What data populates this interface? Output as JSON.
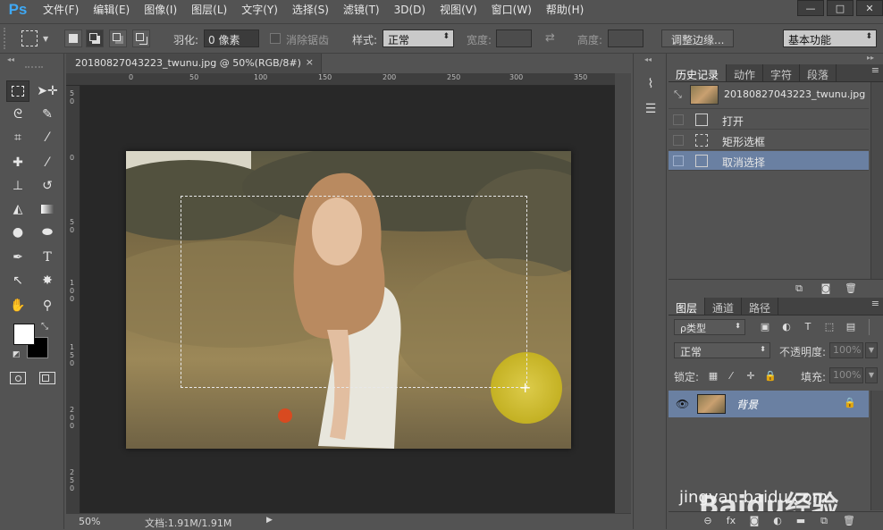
{
  "app": {
    "logo": "Ps"
  },
  "menu": [
    "文件(F)",
    "编辑(E)",
    "图像(I)",
    "图层(L)",
    "文字(Y)",
    "选择(S)",
    "滤镜(T)",
    "3D(D)",
    "视图(V)",
    "窗口(W)",
    "帮助(H)"
  ],
  "window_controls": [
    "—",
    "□",
    "✕"
  ],
  "options": {
    "feather_label": "羽化:",
    "feather_value": "0 像素",
    "antialias_label": "消除锯齿",
    "style_label": "样式:",
    "style_value": "正常",
    "width_label": "宽度:",
    "height_label": "高度:",
    "refine_edge": "调整边缘...",
    "workspace": "基本功能"
  },
  "document": {
    "tab_title": "20180827043223_twunu.jpg @ 50%(RGB/8#)",
    "tab_close": "×",
    "ruler_h_ticks": [
      "0",
      "50",
      "100",
      "150",
      "200",
      "250",
      "300",
      "350"
    ],
    "ruler_v_ticks": [
      "5\n0",
      "0",
      "5\n0",
      "1\n0\n0",
      "1\n5\n0",
      "2\n0\n0",
      "2\n5\n0"
    ],
    "zoom": "50%",
    "doc_info": "文档:1.91M/1.91M"
  },
  "history_panel": {
    "tabs": [
      "历史记录",
      "动作",
      "字符",
      "段落"
    ],
    "snapshot_name": "20180827043223_twunu.jpg",
    "items": [
      {
        "label": "打开",
        "icon": "document-icon",
        "selected": false
      },
      {
        "label": "矩形选框",
        "icon": "marquee-icon",
        "selected": false
      },
      {
        "label": "取消选择",
        "icon": "document-icon",
        "selected": true
      }
    ]
  },
  "layers_panel": {
    "tabs": [
      "图层",
      "通道",
      "路径"
    ],
    "filter_type": "ρ类型",
    "blend_mode": "正常",
    "opacity_label": "不透明度:",
    "opacity_value": "100%",
    "lock_label": "锁定:",
    "fill_label": "填充:",
    "fill_value": "100%",
    "layers": [
      {
        "name": "背景",
        "visible": true,
        "locked": true
      }
    ]
  },
  "watermark": {
    "brand": "Baidu经验",
    "url": "jingyan.baidu.com"
  },
  "colors": {
    "accent": "#3fa9f5",
    "selection": "#6a80a2",
    "highlight": "#d8cb1a"
  }
}
